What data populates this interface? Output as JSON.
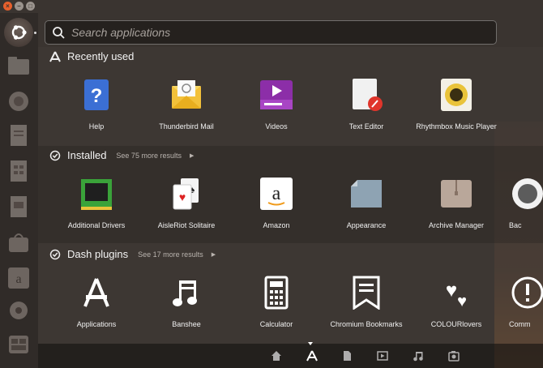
{
  "search": {
    "placeholder": "Search applications"
  },
  "sections": {
    "recent": {
      "title": "Recently used",
      "items": [
        {
          "label": "Help"
        },
        {
          "label": "Thunderbird Mail"
        },
        {
          "label": "Videos"
        },
        {
          "label": "Text Editor"
        },
        {
          "label": "Rhythmbox Music Player"
        }
      ]
    },
    "installed": {
      "title": "Installed",
      "more": "See 75 more results",
      "items": [
        {
          "label": "Additional Drivers"
        },
        {
          "label": "AisleRiot Solitaire"
        },
        {
          "label": "Amazon"
        },
        {
          "label": "Appearance"
        },
        {
          "label": "Archive Manager"
        },
        {
          "label": "Bac"
        }
      ]
    },
    "plugins": {
      "title": "Dash plugins",
      "more": "See 17 more results",
      "items": [
        {
          "label": "Applications"
        },
        {
          "label": "Banshee"
        },
        {
          "label": "Calculator"
        },
        {
          "label": "Chromium Bookmarks"
        },
        {
          "label": "COLOURlovers"
        },
        {
          "label": "Comm"
        }
      ]
    }
  },
  "amazon_glyph": "a",
  "colors": {
    "accent": "#e8602c",
    "help": "#3b6fd4",
    "thunderbird": "#f3c13a",
    "videos": "#8c2ea8",
    "drivers": "#3aa33a",
    "rhythmbox": "#e9c33a"
  }
}
